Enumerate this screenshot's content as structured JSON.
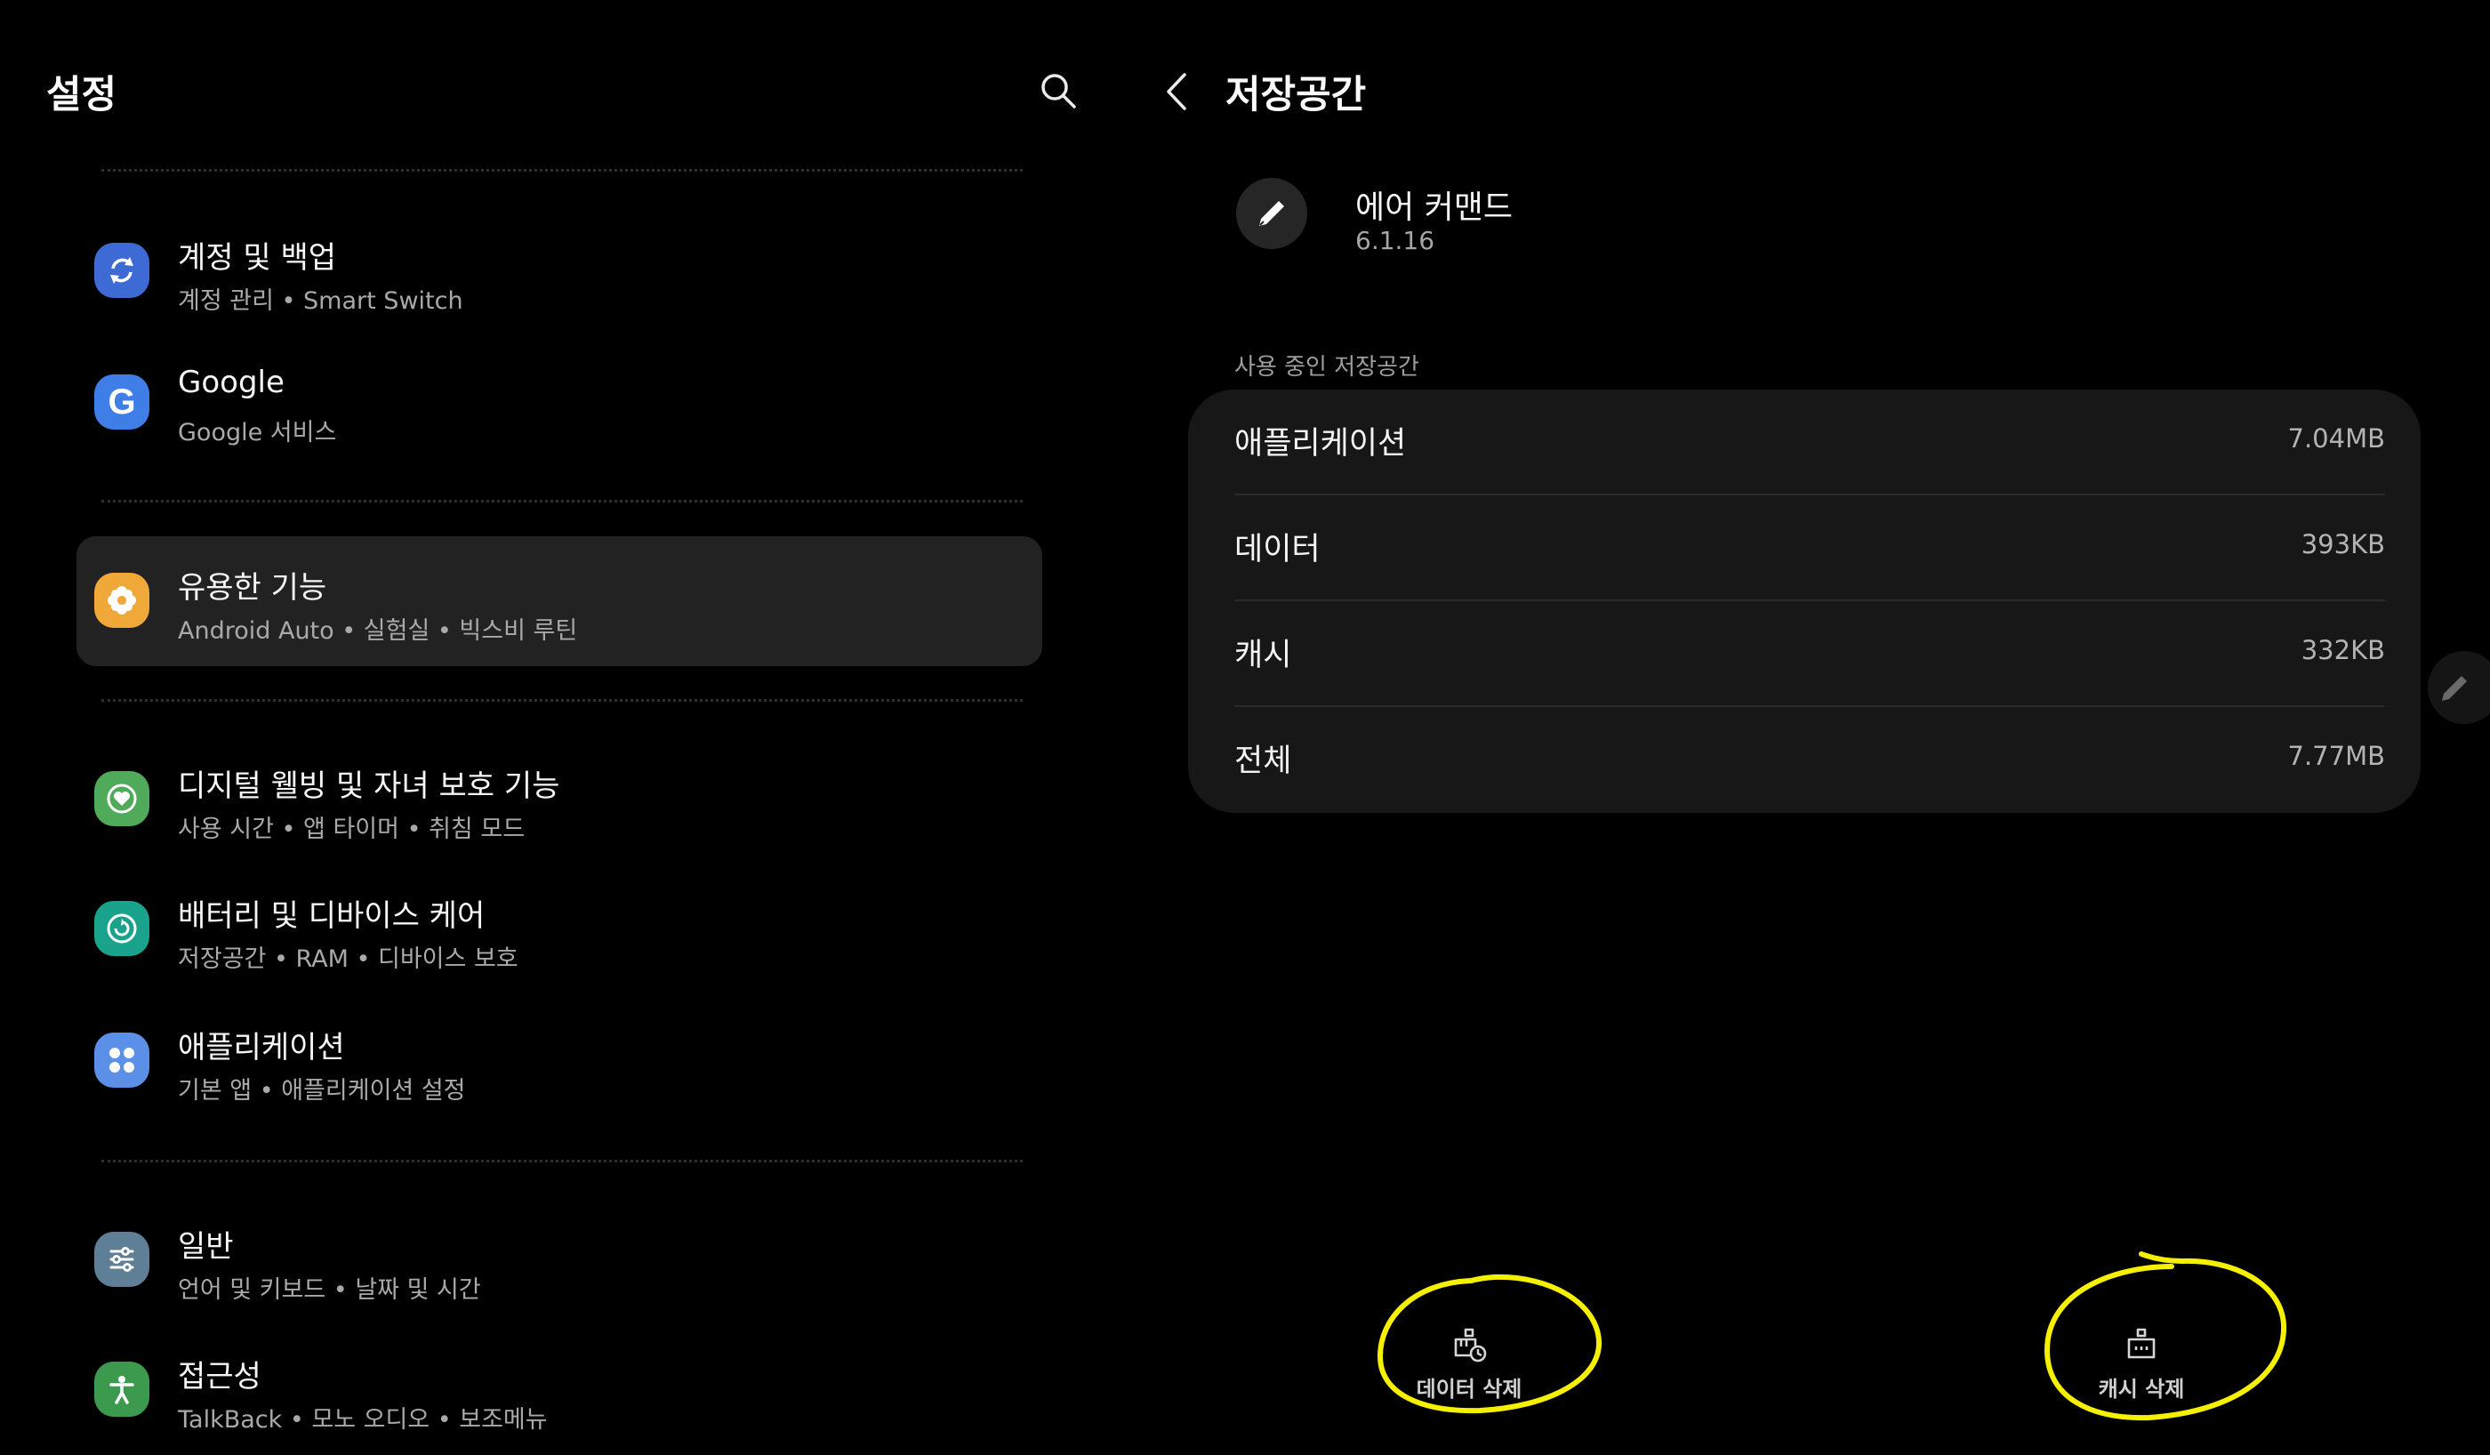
{
  "settings": {
    "title": "설정",
    "items": [
      {
        "title": "계정 및 백업",
        "sub": [
          "계정 관리",
          "Smart Switch"
        ]
      },
      {
        "title": "Google",
        "sub": [
          "Google 서비스"
        ]
      },
      {
        "title": "유용한 기능",
        "sub": [
          "Android Auto",
          "실험실",
          "빅스비 루틴"
        ]
      },
      {
        "title": "디지털 웰빙 및 자녀 보호 기능",
        "sub": [
          "사용 시간",
          "앱 타이머",
          "취침 모드"
        ]
      },
      {
        "title": "배터리 및 디바이스 케어",
        "sub": [
          "저장공간",
          "RAM",
          "디바이스 보호"
        ]
      },
      {
        "title": "애플리케이션",
        "sub": [
          "기본 앱",
          "애플리케이션 설정"
        ]
      },
      {
        "title": "일반",
        "sub": [
          "언어 및 키보드",
          "날짜 및 시간"
        ]
      },
      {
        "title": "접근성",
        "sub": [
          "TalkBack",
          "모노 오디오",
          "보조메뉴"
        ]
      }
    ],
    "selected_index": 2,
    "separator": " • "
  },
  "storage": {
    "title": "저장공간",
    "app_name": "에어 커맨드",
    "app_version": "6.1.16",
    "section_label": "사용 중인 저장공간",
    "rows": [
      {
        "label": "애플리케이션",
        "value": "7.04MB"
      },
      {
        "label": "데이터",
        "value": "393KB"
      },
      {
        "label": "캐시",
        "value": "332KB"
      },
      {
        "label": "전체",
        "value": "7.77MB"
      }
    ],
    "buttons": {
      "clear_data": "데이터 삭제",
      "clear_cache": "캐시 삭제"
    }
  },
  "icons": {
    "search": "search-icon",
    "back": "back-arrow-icon",
    "app": "pen-icon",
    "edge": "pen-icon",
    "accounts": "sync-icon",
    "google": "google-g-icon",
    "advanced": "gear-flower-icon",
    "wellbeing": "heart-circle-icon",
    "battery": "refresh-circle-icon",
    "apps": "four-dots-icon",
    "general": "sliders-icon",
    "accessibility": "person-icon",
    "clear_data": "trash-clock-icon",
    "clear_cache": "trash-icon"
  },
  "colors": {
    "background": "#000000",
    "selected_item": "#222222",
    "card": "#171717",
    "highlight_annotation": "#f5f000",
    "icon_accounts": "#3e6ad6",
    "icon_google": "#3f7ee6",
    "icon_advanced": "#f0a838",
    "icon_wellbeing": "#4faa5a",
    "icon_battery": "#19a28c",
    "icon_apps": "#5b8fe8",
    "icon_general": "#5e7f96",
    "icon_accessibility": "#3c9a4e"
  }
}
